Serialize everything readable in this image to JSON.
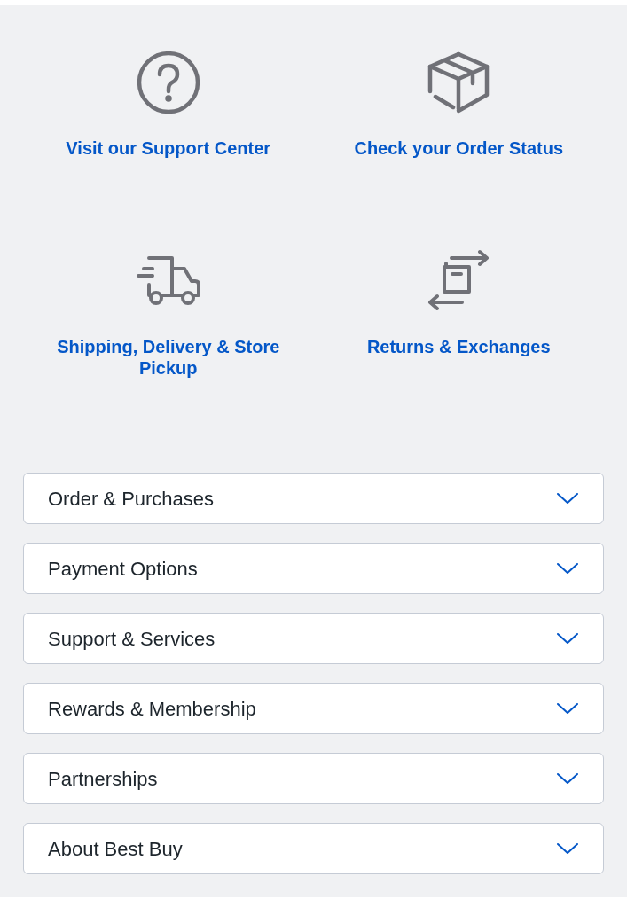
{
  "quick_links": [
    {
      "kind": "help",
      "label": "Visit our Support Center"
    },
    {
      "kind": "box",
      "label": "Check your Order Status"
    },
    {
      "kind": "truck",
      "label": "Shipping, Delivery & Store Pickup"
    },
    {
      "kind": "exchange",
      "label": "Returns & Exchanges"
    }
  ],
  "accordion": [
    {
      "label": "Order & Purchases",
      "expanded": false
    },
    {
      "label": "Payment Options",
      "expanded": false
    },
    {
      "label": "Support & Services",
      "expanded": false
    },
    {
      "label": "Rewards & Membership",
      "expanded": false
    },
    {
      "label": "Partnerships",
      "expanded": false
    },
    {
      "label": "About Best Buy",
      "expanded": false
    }
  ]
}
